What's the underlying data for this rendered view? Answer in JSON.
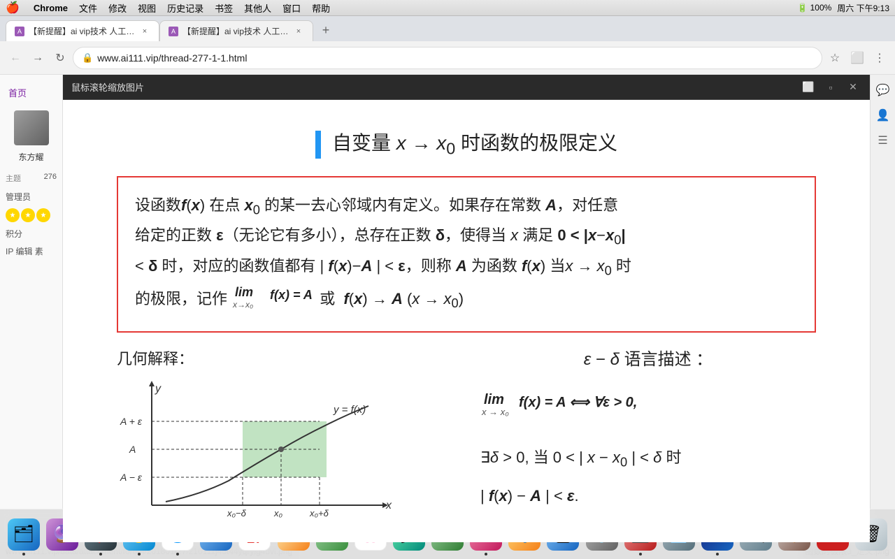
{
  "menubar": {
    "apple": "🍎",
    "items": [
      "Chrome",
      "文件",
      "修改",
      "视图",
      "历史记录",
      "书签",
      "其他人",
      "窗口",
      "帮助"
    ],
    "right_items": [
      "100%",
      "周六 下午9:13"
    ],
    "battery": "100%",
    "time": "周六 下午9:13"
  },
  "tabs": [
    {
      "id": "tab1",
      "title": "【新提醒】ai vip技术 人工智能...",
      "active": true,
      "favicon": "A"
    },
    {
      "id": "tab2",
      "title": "【新提醒】ai vip技术 人工智能...",
      "active": false,
      "favicon": "A"
    }
  ],
  "address_bar": {
    "url": "www.ai111.vip/thread-277-1-1.html"
  },
  "image_viewer": {
    "toolbar_title": "鼠标滚轮缩放图片"
  },
  "math": {
    "title": "自变量 x → x₀ 时函数的极限定义",
    "definition": "设函数 f(x) 在点 x₀ 的某一去心邻域内有定义。如果存在常数 A，对任意给定的正数 ε（无论它有多小），总存在正数 δ，使得当 x 满足 0 < |x−x₀| < δ 时，对应的函数值都有 |f(x)−A| < ε，则称 A 为函数 f(x) 当 x → x₀ 时的极限，记作 lim(x→x₀) f(x) = A 或 f(x) → A (x → x₀)",
    "geo_label": "几何解释：",
    "epsilon_delta_title": "ε − δ 语言描述：",
    "formula_line1": "lim(x→x₀) f(x) = A  ⟺  ∀ε > 0,",
    "formula_line2": "∃δ > 0, 当 0 < |x − x₀| < δ 时",
    "formula_line3": "|f(x) − A| < ε."
  },
  "status_bar": {
    "url": "www.ai111.vip/data/attachment/forum/201801/27/210111j45t44yqrylg4uvl.png",
    "filename": "函数的极限3_定义.png"
  },
  "sidebar": {
    "home": "首页",
    "user": "东方耀",
    "topics": "276",
    "topics_label": "主题",
    "role": "管理员",
    "points_label": "积分",
    "ip_label": "IP 编辑 素"
  },
  "dock": {
    "items": [
      {
        "name": "finder",
        "color": "#2196f3",
        "label": "Finder",
        "char": "🗂"
      },
      {
        "name": "siri",
        "color": "#9c27b0",
        "label": "Siri",
        "char": "🔮"
      },
      {
        "name": "launchpad",
        "color": "#333",
        "label": "Launchpad",
        "char": "🚀"
      },
      {
        "name": "safari",
        "color": "#2196f3",
        "label": "Safari",
        "char": "🧭"
      },
      {
        "name": "chrome",
        "color": "#4caf50",
        "label": "Chrome",
        "char": "🌐"
      },
      {
        "name": "mail",
        "color": "#2196f3",
        "label": "Mail",
        "char": "✉️"
      },
      {
        "name": "calendar",
        "color": "#e53935",
        "label": "Calendar",
        "char": "📅"
      },
      {
        "name": "keynote",
        "color": "#ff9800",
        "label": "Keynote",
        "char": "🎯"
      },
      {
        "name": "maps",
        "color": "#4caf50",
        "label": "Maps",
        "char": "🗺"
      },
      {
        "name": "photos",
        "color": "#ff5722",
        "label": "Photos",
        "char": "🌸"
      },
      {
        "name": "messages",
        "color": "#4caf50",
        "label": "Messages",
        "char": "💬"
      },
      {
        "name": "facetime",
        "color": "#4caf50",
        "label": "FaceTime",
        "char": "📹"
      },
      {
        "name": "music",
        "color": "#e91e63",
        "label": "Music",
        "char": "🎵"
      },
      {
        "name": "ibooks",
        "color": "#ff9800",
        "label": "iBooks",
        "char": "📚"
      },
      {
        "name": "appstore",
        "color": "#2196f3",
        "label": "App Store",
        "char": "🅰"
      },
      {
        "name": "settings",
        "color": "#9e9e9e",
        "label": "System Prefs",
        "char": "⚙️"
      },
      {
        "name": "screenflow",
        "color": "#e53935",
        "label": "ScreenFlow",
        "char": "🎬"
      },
      {
        "name": "finder2",
        "color": "#607d8b",
        "label": "Finder2",
        "char": "📄"
      },
      {
        "name": "photoshop",
        "color": "#1565c0",
        "label": "Photoshop",
        "char": "Ps"
      },
      {
        "name": "finder3",
        "color": "#78909c",
        "label": "Finder3",
        "char": "🔍"
      },
      {
        "name": "archive",
        "color": "#795548",
        "label": "Archive",
        "char": "📦"
      },
      {
        "name": "parallels",
        "color": "#e53935",
        "label": "Parallels",
        "char": "⬜"
      },
      {
        "name": "trash",
        "color": "#607d8b",
        "label": "Trash",
        "char": "🗑"
      }
    ]
  }
}
